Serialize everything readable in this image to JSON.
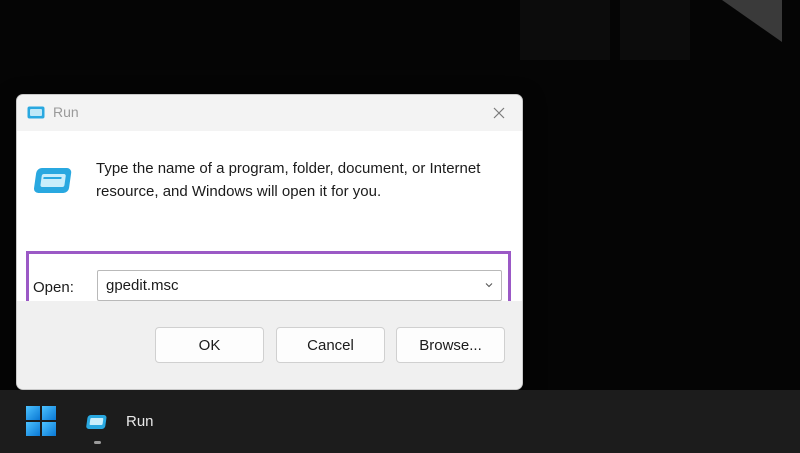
{
  "dialog": {
    "title": "Run",
    "description": "Type the name of a program, folder, document, or Internet resource, and Windows will open it for you.",
    "open_label": "Open:",
    "open_value": "gpedit.msc",
    "ok_label": "OK",
    "cancel_label": "Cancel",
    "browse_label": "Browse..."
  },
  "taskbar": {
    "run_label": "Run"
  },
  "colors": {
    "highlight": "#9b59c6",
    "icon_blue": "#29a8e0"
  },
  "icons": [
    "run-icon",
    "close-icon",
    "chevron-down-icon",
    "windows-start-icon"
  ]
}
